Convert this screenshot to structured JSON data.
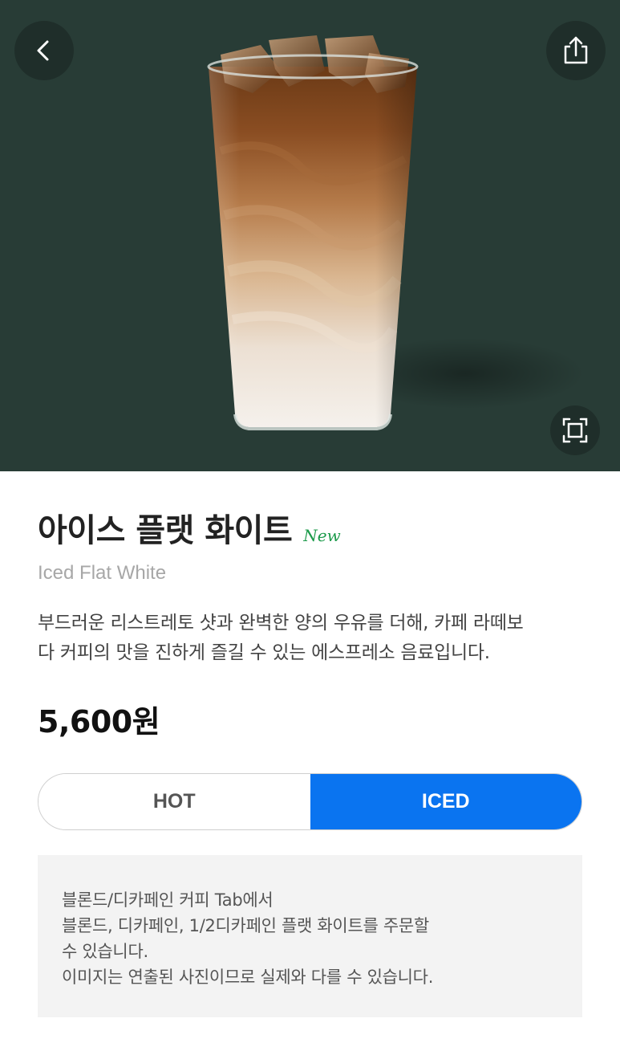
{
  "hero": {
    "background_color": "#283c36",
    "back_icon": "chevron-left-icon",
    "share_icon": "share-icon",
    "expand_icon": "expand-icon",
    "image_subject": "iced flat white drink in glass"
  },
  "product": {
    "name_ko": "아이스 플랫 화이트",
    "badge": "New",
    "name_en": "Iced Flat White",
    "description": "부드러운 리스트레토 샷과 완벽한 양의 우유를 더해, 카페 라떼보\n다 커피의 맛을 진하게 즐길 수 있는 에스프레소 음료입니다.",
    "price": "5,600원"
  },
  "temperature": {
    "options": [
      "HOT",
      "ICED"
    ],
    "selected": "ICED",
    "accent_color": "#0a74f0"
  },
  "notice": {
    "lines": [
      "블론드/디카페인 커피 Tab에서",
      "블론드, 디카페인, 1/2디카페인 플랫 화이트를 주문할",
      "수 있습니다.",
      "이미지는 연출된 사진이므로 실제와 다를 수 있습니다."
    ]
  }
}
